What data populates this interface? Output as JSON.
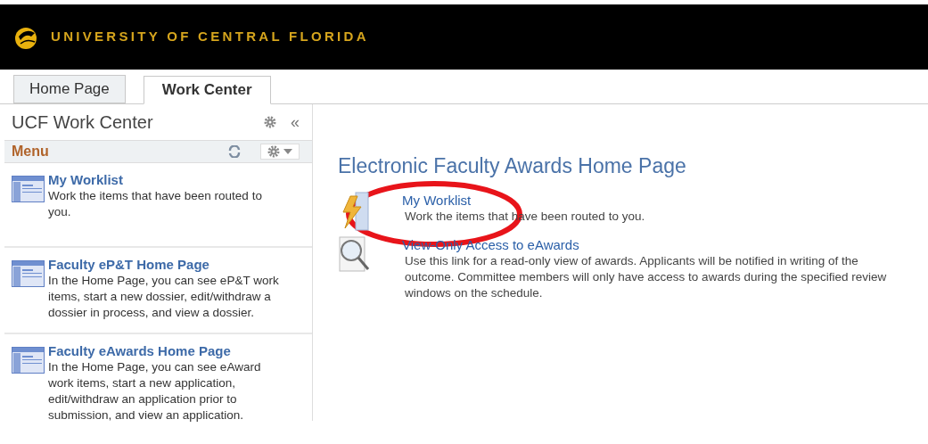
{
  "header": {
    "title": "UNIVERSITY OF CENTRAL FLORIDA"
  },
  "tabs": [
    {
      "label": "Home Page",
      "selected": false
    },
    {
      "label": "Work Center",
      "selected": true
    }
  ],
  "sidebar": {
    "title": "UCF Work Center",
    "menu_label": "Menu",
    "collapse_label": "«",
    "items": [
      {
        "title": "My Worklist",
        "description": "Work the items that have been routed to you."
      },
      {
        "title": "Faculty eP&T Home Page",
        "description": "In the Home Page, you can see eP&T work items, start a new dossier, edit/withdraw a dossier in process, and view a dossier."
      },
      {
        "title": "Faculty eAwards Home Page",
        "description": "In the Home Page, you can see eAward work items, start a new application, edit/withdraw an application prior to submission, and view an application."
      }
    ]
  },
  "main": {
    "title": "Electronic Faculty Awards Home Page",
    "links": [
      {
        "kind": "worklist",
        "title": "My Worklist",
        "description": "Work the items that have been routed to you.",
        "circled": true
      },
      {
        "kind": "search",
        "title": "View-Only Access to eAwards",
        "description": "Use this link for a read-only view of awards. Applicants will be notified in writing of the outcome.  Committee members will only have access to awards during the specified review windows on the schedule.",
        "circled": false
      }
    ]
  }
}
